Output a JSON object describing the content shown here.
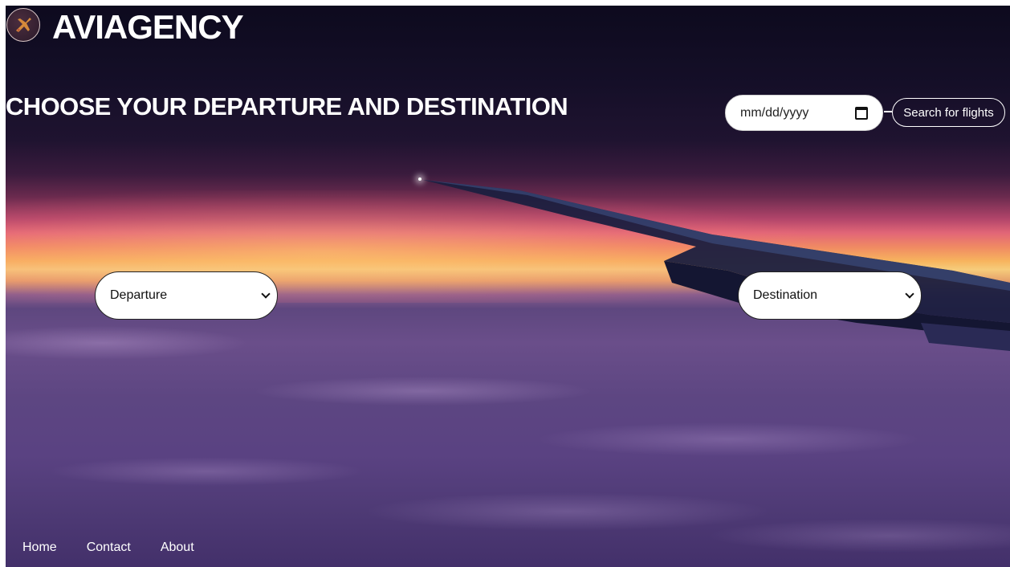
{
  "brand": {
    "name": "AVIAGENCY",
    "logo_icon": "plane-logo-icon"
  },
  "headline": "CHOOSE YOUR DEPARTURE AND DESTINATION",
  "date_field": {
    "placeholder": "mm/dd/yyyy",
    "icon": "calendar-icon"
  },
  "search_button": {
    "label": "Search for flights"
  },
  "departure": {
    "selected": "Departure",
    "icon": "chevron-down-icon"
  },
  "destination": {
    "selected": "Destination",
    "icon": "chevron-down-icon"
  },
  "nav": {
    "home": "Home",
    "contact": "Contact",
    "about": "About"
  },
  "background": {
    "description_icon": "sunset-wing-background"
  }
}
